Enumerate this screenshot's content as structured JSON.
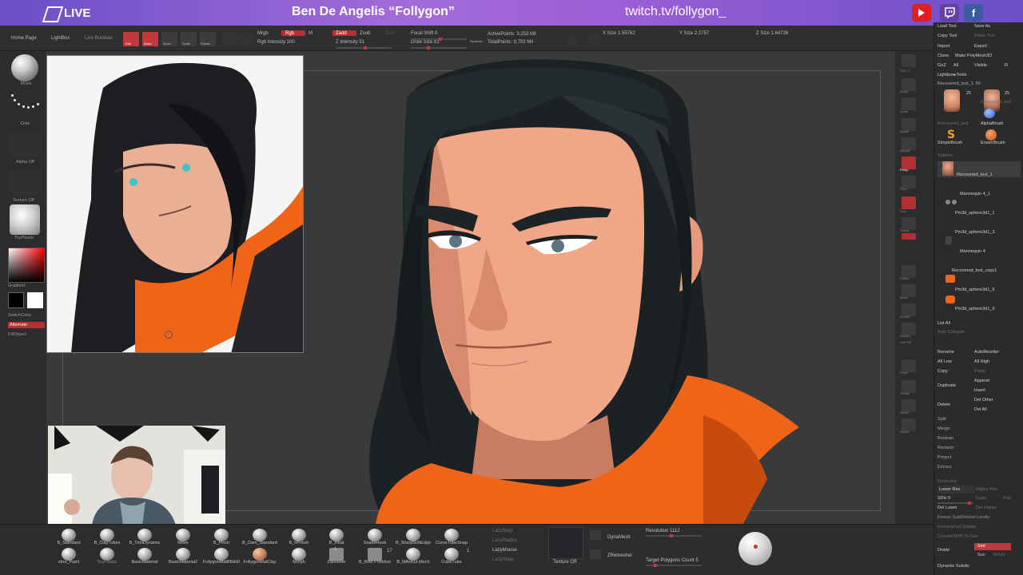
{
  "banner": {
    "logo_text": "LIVE",
    "streamer": "Ben De Angelis “Follygon”",
    "url": "twitch.tv/follygon_",
    "social": {
      "youtube": "youtube-icon",
      "twitch": "twitch-icon",
      "facebook": "f"
    }
  },
  "toolbar": {
    "home": "Home Page",
    "lightbox": "LightBox",
    "live_boolean": "Live Boolean",
    "edit": "Edit",
    "draw": "Draw",
    "move": "Move",
    "scale": "Scale",
    "rotate": "Rotate",
    "mrgb": "Mrgb",
    "rgb": "Rgb",
    "m": "M",
    "rgb_intensity": "Rgb Intensity 100",
    "zadd": "Zadd",
    "zsub": "Zsub",
    "zcut": "Zcut",
    "z_intensity": "Z Intensity 51",
    "focal_shift": "Focal Shift 0",
    "draw_size": "Draw Size 81",
    "dynamic": "Dynamic",
    "active_points": "ActivePoints: 3,253 Mil",
    "total_points": "TotalPoints: 9,792 Mil",
    "x_size": "X Size 1.55762",
    "y_size": "Y Size 2.2757",
    "z_size": "Z Size 1.64726"
  },
  "left_tray": {
    "brush_label": "Move",
    "stroke_label": "Dots",
    "alpha_label": "Alpha Off",
    "texture_label": "Texture Off",
    "material_label": "ToyPlastic",
    "gradient_label": "Gradient",
    "switch_color": "SwitchColor",
    "alternate": "Alternate",
    "fill_object": "FillObject"
  },
  "right_panel": {
    "load_tool": "Load Tool",
    "save_as": "Save As",
    "copy_tool": "Copy Tool",
    "paste_tool": "Paste Tool",
    "import": "Import",
    "export": "Export",
    "clone": "Clone",
    "make_polymesh": "Make PolyMesh3D",
    "goz": "GoZ",
    "all": "All",
    "visible": "Visible",
    "r": "R",
    "lightbox_tools": "Lightbox▸Tools",
    "recovered_tool": "Recovered_tool_1. 50",
    "thumb_count_1": "25",
    "thumb_count_2": "25",
    "thumb_label_1": "Recovered_tool",
    "thumb_label_2": "Recovered_tool",
    "alpha_brush": "AlphaBrush",
    "simple_brush": "SimpleBrush",
    "eraser_brush": "EraserBrush",
    "subtool_header": "Subtool",
    "subtools": [
      "Recovered_tool_1",
      "Mannequin 4_1",
      "Pm3d_sphere3d1_1",
      "Pm3d_sphere3d1_3",
      "Mannequin 4",
      "Recovered_tool_copy1",
      "Pm3d_sphere3d1_6",
      "Pm3d_sphere3d1_9"
    ],
    "list_all": "List All",
    "auto_collapse": "Auto Collapse",
    "rename": "Rename",
    "auto_reorder": "AutoReorder",
    "all_low": "All Low",
    "all_high": "All High",
    "copy": "Copy",
    "paste": "Paste",
    "duplicate": "Duplicate",
    "append": "Append",
    "insert": "Insert",
    "delete": "Delete",
    "del_other": "Del Other",
    "del_all": "Del All",
    "split": "Split",
    "merge": "Merge",
    "boolean": "Boolean",
    "remesh": "Remesh",
    "project": "Project",
    "extract": "Extract",
    "geometry": "Geometry",
    "lower_res": "Lower Res",
    "higher_res": "Higher Res",
    "sdiv": "SDiv 5",
    "cage": "Cage",
    "rstr": "Rstr",
    "del_lower": "Del Lower",
    "del_higher": "Del Higher",
    "freeze_subdiv": "Freeze SubDivision Levels",
    "reconstruct_subdiv": "Reconstruct Subdiv",
    "convert_bpr": "Convert BPR To Geo",
    "divide": "Divide",
    "smt": "Smt",
    "suv": "Suv",
    "reuv": "ReUV",
    "dynamic_subdiv": "Dynamic Subdiv"
  },
  "bottom_tray": {
    "brushes_row1": [
      "B_Standard",
      "B_ClayTubes",
      "B_TrimDynamic",
      "Move",
      "B_Pinch",
      "B_Dam_Standard",
      "B_hPolish",
      "B_Inflat",
      "SnakeHook",
      "B_SharpSoftEdge",
      "CurveTubeSnap"
    ],
    "brushes_row2": [
      "zbro_Paint",
      "ToyPlastic",
      "BasicMaterial",
      "BasicMaterial2",
      "FollygonMatBB&W",
      "FollygonMatClay",
      "Morph",
      "ZModeler",
      "B_IMM Primitive",
      "B_MAHcut Mech",
      "CubeTube"
    ],
    "count_1": "1",
    "count_17": "17",
    "count_2": "1",
    "lazy_step": "LazyStep",
    "lazy_radius": "LazyRadius",
    "lazy_mouse": "LazyMouse",
    "lazy_snap": "LazySnap",
    "texture_off": "Texture Off",
    "dynamesh": "DynaMesh",
    "resolution": "Resolution 1112",
    "zremesher": "ZRemesher",
    "target_polys": "Target Polygons Count 5"
  },
  "right_shelf": [
    "SPix 3",
    "Scroll",
    "Zoom",
    "Actual",
    "AAHalf",
    "Persp",
    "Floor",
    "Solo",
    "Transp",
    "Frame",
    "Move",
    "ZoomD",
    "RotaTe",
    "Line Fill",
    "PolyF",
    "Transp",
    "Ghost",
    "Xpose"
  ],
  "colors": {
    "accent_red": "#b53134",
    "banner_purple": "#8f5ed4",
    "hoodie_orange": "#f06418"
  }
}
